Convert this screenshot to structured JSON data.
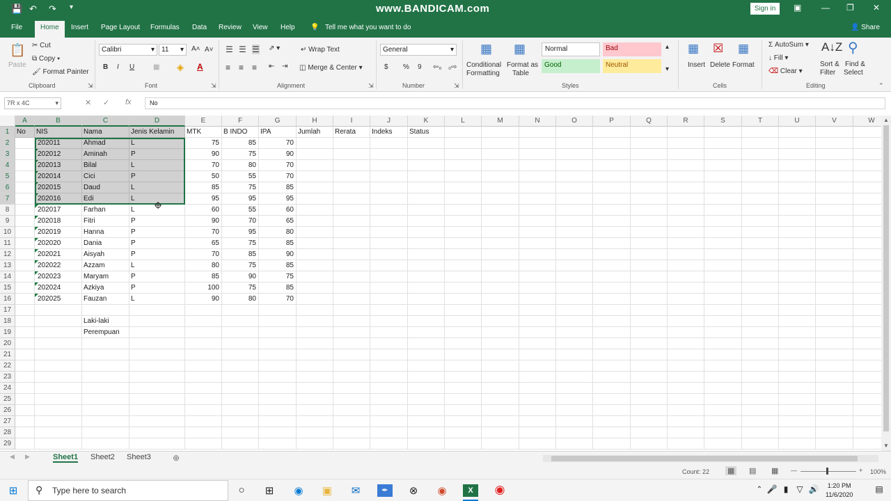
{
  "title": "www.BANDICAM.com",
  "titlebar": {
    "sign_in": "Sign in"
  },
  "tabs": [
    "File",
    "Home",
    "Insert",
    "Page Layout",
    "Formulas",
    "Data",
    "Review",
    "View",
    "Help"
  ],
  "tell_me": "Tell me what you want to do",
  "share": "Share",
  "ribbon": {
    "clipboard": {
      "paste": "Paste",
      "cut": "Cut",
      "copy": "Copy",
      "format_painter": "Format Painter",
      "label": "Clipboard"
    },
    "font": {
      "name": "Calibri",
      "size": "11",
      "bold": "B",
      "italic": "I",
      "underline": "U",
      "label": "Font"
    },
    "alignment": {
      "wrap_text": "Wrap Text",
      "merge_center": "Merge & Center",
      "label": "Alignment"
    },
    "number": {
      "format": "General",
      "currency": "$",
      "percent": "%",
      "comma": "9",
      "label": "Number"
    },
    "styles": {
      "conditional": "Conditional",
      "conditional2": "Formatting",
      "format_as_table": "Format as",
      "format_as_table2": "Table",
      "normal": "Normal",
      "bad": "Bad",
      "good": "Good",
      "neutral": "Neutral",
      "label": "Styles"
    },
    "cells": {
      "insert": "Insert",
      "delete": "Delete",
      "format": "Format",
      "label": "Cells"
    },
    "editing": {
      "autosum": "AutoSum",
      "fill": "Fill",
      "clear": "Clear",
      "sort_filter": "Sort &",
      "sort_filter2": "Filter",
      "find_select": "Find &",
      "find_select2": "Select",
      "label": "Editing"
    }
  },
  "formula_bar": {
    "name_box": "7R x 4C",
    "fx": "fx",
    "content": "No"
  },
  "columns": [
    "A",
    "B",
    "C",
    "D",
    "E",
    "F",
    "G",
    "H",
    "I",
    "J",
    "K",
    "L",
    "M",
    "N",
    "O",
    "P",
    "Q",
    "R",
    "S",
    "T",
    "U",
    "V",
    "W"
  ],
  "rows": [
    "1",
    "2",
    "3",
    "4",
    "5",
    "6",
    "7",
    "8",
    "9",
    "10",
    "11",
    "12",
    "13",
    "14",
    "15",
    "16",
    "17",
    "18",
    "19",
    "20",
    "21",
    "22",
    "23",
    "24",
    "25",
    "26",
    "27",
    "28",
    "29"
  ],
  "headers": [
    "No",
    "NIS",
    "Nama",
    "Jenis Kelamin",
    "MTK",
    "B INDO",
    "IPA",
    "Jumlah",
    "Rerata",
    "Indeks",
    "Status"
  ],
  "students": [
    {
      "nis": "202011",
      "nama": "Ahmad",
      "jk": "L",
      "mtk": "75",
      "bindo": "85",
      "ipa": "70"
    },
    {
      "nis": "202012",
      "nama": "Aminah",
      "jk": "P",
      "mtk": "90",
      "bindo": "75",
      "ipa": "90"
    },
    {
      "nis": "202013",
      "nama": "Bilal",
      "jk": "L",
      "mtk": "70",
      "bindo": "80",
      "ipa": "70"
    },
    {
      "nis": "202014",
      "nama": "Cici",
      "jk": "P",
      "mtk": "50",
      "bindo": "55",
      "ipa": "70"
    },
    {
      "nis": "202015",
      "nama": "Daud",
      "jk": "L",
      "mtk": "85",
      "bindo": "75",
      "ipa": "85"
    },
    {
      "nis": "202016",
      "nama": "Edi",
      "jk": "L",
      "mtk": "95",
      "bindo": "95",
      "ipa": "95"
    },
    {
      "nis": "202017",
      "nama": "Farhan",
      "jk": "L",
      "mtk": "60",
      "bindo": "55",
      "ipa": "60"
    },
    {
      "nis": "202018",
      "nama": "Fitri",
      "jk": "P",
      "mtk": "90",
      "bindo": "70",
      "ipa": "65"
    },
    {
      "nis": "202019",
      "nama": "Hanna",
      "jk": "P",
      "mtk": "70",
      "bindo": "95",
      "ipa": "80"
    },
    {
      "nis": "202020",
      "nama": "Dania",
      "jk": "P",
      "mtk": "65",
      "bindo": "75",
      "ipa": "85"
    },
    {
      "nis": "202021",
      "nama": "Aisyah",
      "jk": "P",
      "mtk": "70",
      "bindo": "85",
      "ipa": "90"
    },
    {
      "nis": "202022",
      "nama": "Azzam",
      "jk": "L",
      "mtk": "80",
      "bindo": "75",
      "ipa": "85"
    },
    {
      "nis": "202023",
      "nama": "Maryam",
      "jk": "P",
      "mtk": "85",
      "bindo": "90",
      "ipa": "75"
    },
    {
      "nis": "202024",
      "nama": "Azkiya",
      "jk": "P",
      "mtk": "100",
      "bindo": "75",
      "ipa": "85"
    },
    {
      "nis": "202025",
      "nama": "Fauzan",
      "jk": "L",
      "mtk": "90",
      "bindo": "80",
      "ipa": "70"
    }
  ],
  "notes": [
    "Laki-laki",
    "Perempuan"
  ],
  "sheets": [
    "Sheet1",
    "Sheet2",
    "Sheet3"
  ],
  "status": {
    "count": "Count: 22",
    "zoom": "100%"
  },
  "taskbar": {
    "search_placeholder": "Type here to search",
    "time": "1:20 PM",
    "date": "11/6/2020"
  }
}
